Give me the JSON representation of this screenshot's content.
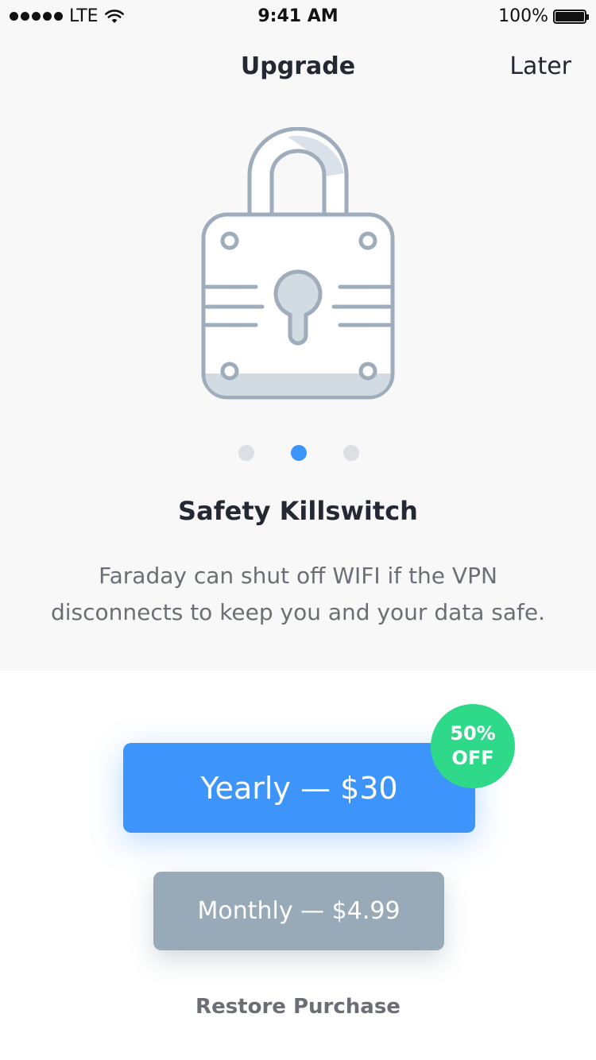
{
  "status_bar": {
    "carrier": "LTE",
    "time": "9:41 AM",
    "battery_percent": "100%"
  },
  "nav": {
    "title": "Upgrade",
    "later_label": "Later"
  },
  "illustration": {
    "icon": "padlock-icon",
    "stroke_color": "#9eacbb",
    "fill_color": "#d2dae2"
  },
  "pager": {
    "count": 3,
    "active_index": 1,
    "active_color": "#3d95fb",
    "inactive_color": "#dcdfe3"
  },
  "feature": {
    "title": "Safety Killswitch",
    "description": "Faraday can shut off WIFI if the VPN disconnects to keep you and your data safe."
  },
  "plans": {
    "yearly_label": "Yearly — $30",
    "yearly_color": "#3d95fb",
    "badge_line1": "50%",
    "badge_line2": "OFF",
    "badge_color": "#2fd98a",
    "monthly_label": "Monthly — $4.99",
    "monthly_color": "#98a9b8"
  },
  "restore_label": "Restore Purchase"
}
